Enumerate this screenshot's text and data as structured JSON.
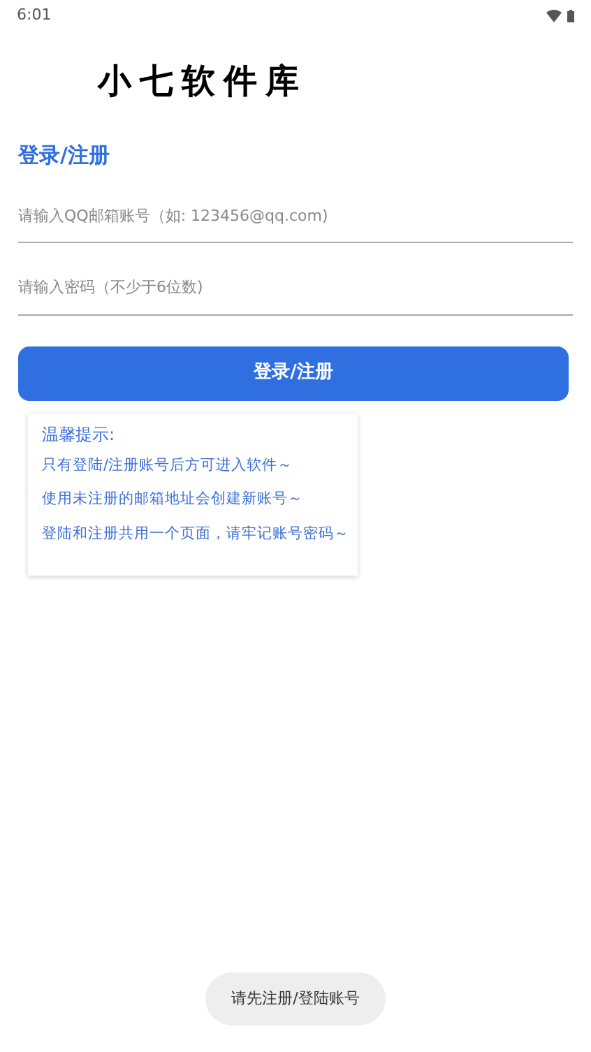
{
  "status_bar": {
    "time": "6:01"
  },
  "logo": "小七软件库",
  "heading": "登录/注册",
  "email_field": {
    "placeholder": "请输入QQ邮箱账号（如: 123456@qq.com)"
  },
  "password_field": {
    "placeholder": "请输入密码（不少于6位数)"
  },
  "submit_button": "登录/注册",
  "tips": {
    "title": "温馨提示:",
    "lines": [
      "只有登陆/注册账号后方可进入软件～",
      "使用未注册的邮箱地址会创建新账号～",
      "登陆和注册共用一个页面，请牢记账号密码～"
    ]
  },
  "toast": "请先注册/登陆账号"
}
